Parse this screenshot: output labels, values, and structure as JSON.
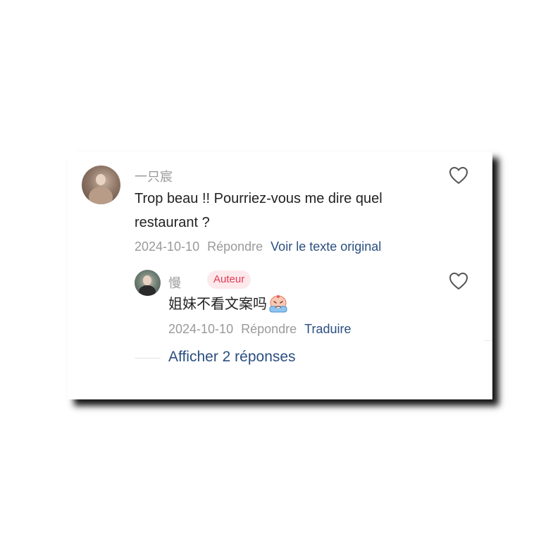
{
  "comment": {
    "username": "一只宸",
    "text": "Trop beau !! Pourriez-vous me dire quel restaurant ?",
    "date": "2024-10-10",
    "reply_label": "Répondre",
    "translate_label": "Voir le texte original"
  },
  "reply": {
    "username": "慢",
    "badge": "Auteur",
    "text": "姐妹不看文案吗",
    "emoji": "crying-face-emoji",
    "date": "2024-10-10",
    "reply_label": "Répondre",
    "translate_label": "Traduire"
  },
  "show_replies_label": "Afficher 2 réponses",
  "colors": {
    "link": "#2a4e80",
    "meta": "#9a9a9a",
    "badge_text": "#e23a55",
    "badge_bg": "#fde9ec",
    "text": "#222222"
  },
  "icons": [
    "heart-icon",
    "avatar"
  ]
}
